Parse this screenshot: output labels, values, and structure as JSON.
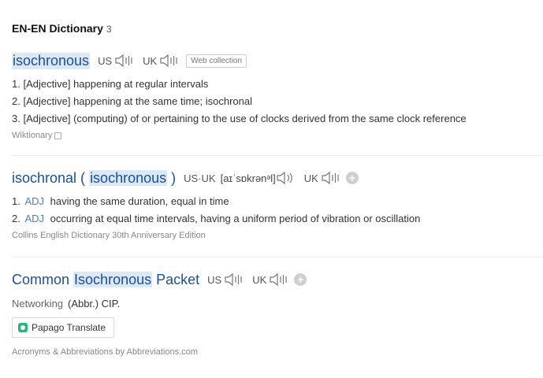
{
  "section": {
    "title": "EN-EN Dictionary",
    "count": "3"
  },
  "entries": [
    {
      "headword": "isochronous",
      "us_label": "US",
      "uk_label": "UK",
      "badge": "Web collection",
      "definitions": [
        {
          "num": "1.",
          "pos": "[Adjective]",
          "text": "happening at regular intervals"
        },
        {
          "num": "2.",
          "pos": "[Adjective]",
          "text": "happening at the same time; isochronal"
        },
        {
          "num": "3.",
          "pos": "[Adjective]",
          "text": "(computing) of or pertaining to the use of clocks derived from the same clock reference"
        }
      ],
      "source": "Wiktionary"
    },
    {
      "headword_prefix": "isochronal (",
      "headword_highlight": "isochronous",
      "headword_suffix": ")",
      "uk_us_label": "US·UK",
      "ipa": "[aɪˈsɒkrənᵊl]",
      "uk_label": "UK",
      "definitions": [
        {
          "num": "1.",
          "pos": "ADJ",
          "text": "having the same duration, equal in time"
        },
        {
          "num": "2.",
          "pos": "ADJ",
          "text": "occurring at equal time intervals, having a uniform period of vibration or oscillation"
        }
      ],
      "source": "Collins English Dictionary 30th Anniversary Edition"
    },
    {
      "headword_prefix": "Common",
      "headword_highlight": "Isochronous",
      "headword_suffix": "Packet",
      "us_label": "US",
      "uk_label": "UK",
      "category": "Networking",
      "meaning": "(Abbr.) CIP.",
      "papago_label": "Papago Translate",
      "source": "Acronyms & Abbreviations by Abbreviations.com"
    }
  ],
  "icons": {
    "speaker": "speaker-icon",
    "plus": "plus-icon",
    "copy": "copy-icon",
    "papago": "papago-icon"
  },
  "colors": {
    "headword": "#1a4fa0",
    "highlight": "#dbe9f7",
    "pos_collins": "#4a7fc1",
    "papago": "#1fb97a"
  }
}
